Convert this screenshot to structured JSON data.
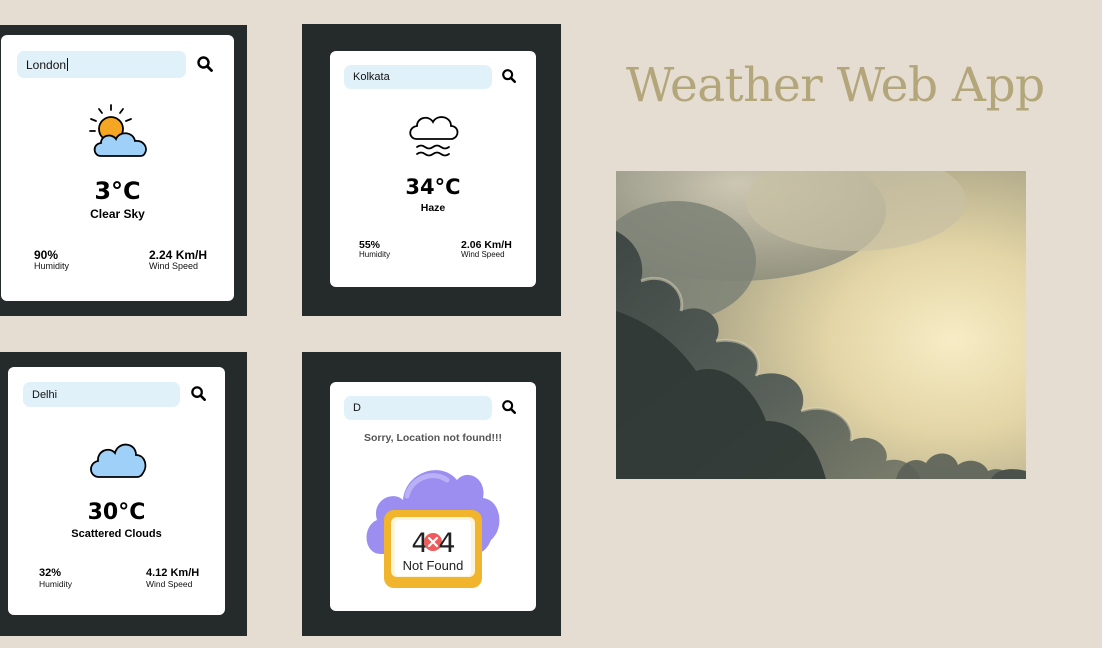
{
  "app_title": "Weather Web App",
  "cards": [
    {
      "city": "London",
      "icon": "sun-behind-cloud-icon",
      "temp": "3°C",
      "desc": "Clear Sky",
      "humidity": "90%",
      "humidity_label": "Humidity",
      "wind": "2.24 Km/H",
      "wind_label": "Wind Speed"
    },
    {
      "city": "Kolkata",
      "icon": "haze-icon",
      "temp": "34°C",
      "desc": "Haze",
      "humidity": "55%",
      "humidity_label": "Humidity",
      "wind": "2.06 Km/H",
      "wind_label": "Wind Speed"
    },
    {
      "city": "Delhi",
      "icon": "cloud-icon",
      "temp": "30°C",
      "desc": "Scattered Clouds",
      "humidity": "32%",
      "humidity_label": "Humidity",
      "wind": "4.12 Km/H",
      "wind_label": "Wind Speed"
    },
    {
      "city": "D",
      "icon": "not-found-icon",
      "error": "Sorry, Location not found!!!",
      "badge_code": "4×4",
      "badge_text": "Not Found"
    }
  ],
  "colors": {
    "background": "#e5ddd1",
    "frame": "#252b2b",
    "search_bg": "#e1f1f9",
    "title": "#b3a67a",
    "sun": "#f5a623",
    "cloud": "#9fd0f8",
    "notfound_cloud": "#9b8ef0",
    "notfound_tablet": "#f0b52c"
  }
}
